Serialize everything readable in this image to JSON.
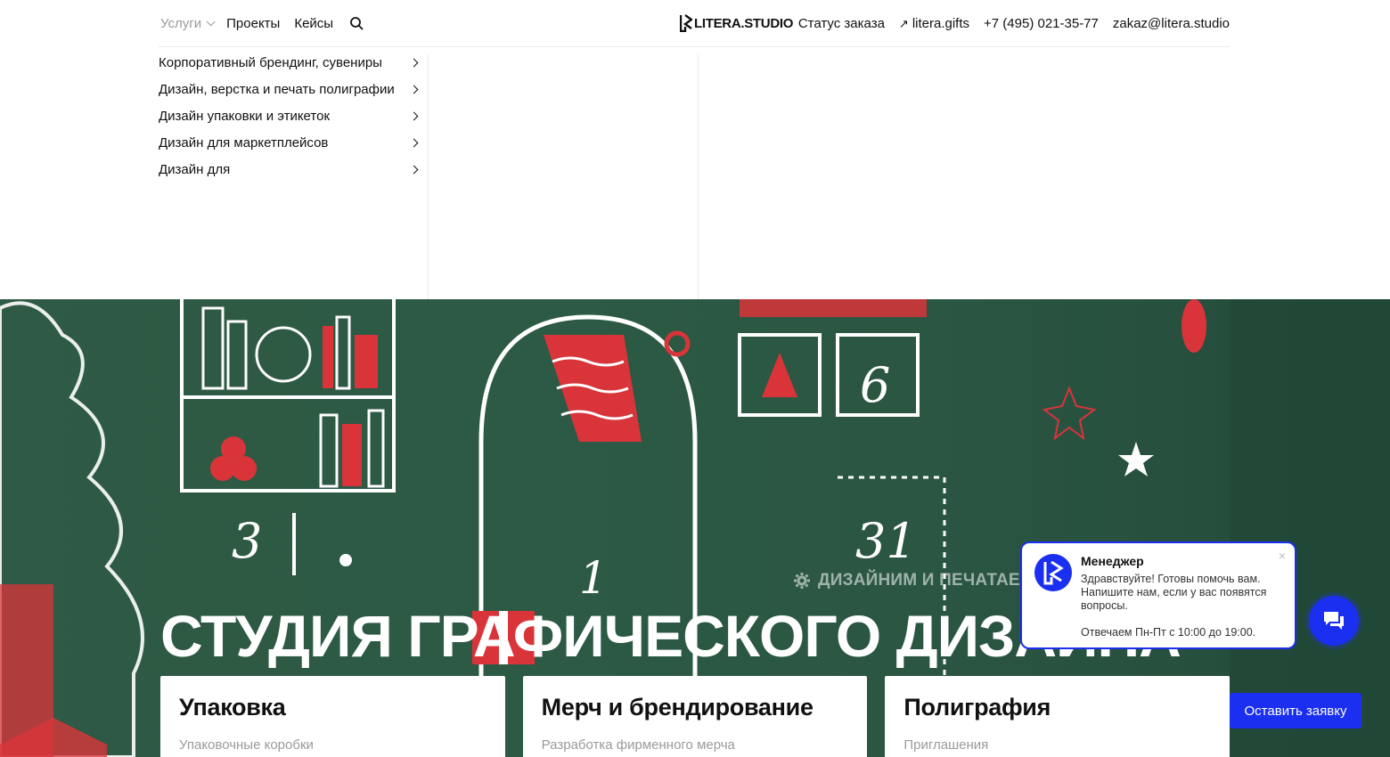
{
  "header": {
    "nav": [
      {
        "label": "Услуги"
      },
      {
        "label": "Проекты"
      },
      {
        "label": "Кейсы"
      }
    ],
    "logo_text": "LITERA.STUDIO",
    "right": {
      "order_status": "Статус заказа",
      "gifts_link": "litera.gifts",
      "phone": "+7 (495) 021-35-77",
      "email": "zakaz@litera.studio"
    }
  },
  "services_menu": {
    "items": [
      {
        "label": "Корпоративный брендинг, сувениры"
      },
      {
        "label": "Дизайн, верстка и печать полиграфии"
      },
      {
        "label": "Дизайн упаковки и этикеток"
      },
      {
        "label": "Дизайн для маркетплейсов"
      },
      {
        "label": "Дизайн для"
      }
    ]
  },
  "hero": {
    "tagline": "ДИЗАЙНИМ И ПЕЧАТАЕМ Н",
    "headline": "СТУДИЯ ГРАФИЧЕСКОГО ДИЗАЙНА",
    "cards": [
      {
        "title": "Упаковка",
        "subtitle": "Упаковочные коробки"
      },
      {
        "title": "Мерч и брендирование",
        "subtitle": "Разработка фирменного мерча"
      },
      {
        "title": "Полиграфия",
        "subtitle": "Приглашения"
      }
    ],
    "cta_label": "Оставить заявку"
  },
  "chat": {
    "manager": "Менеджер",
    "message": "Здравствуйте! Готовы помочь вам. Напишите нам, если у вас появятся вопросы.",
    "hours": "Отвечаем Пн-Пт с 10:00 до 19:00.",
    "close": "×"
  },
  "colors": {
    "accent": "#1a2ff0",
    "hero_green": "#2c5a44",
    "art_red": "#d9343a"
  }
}
